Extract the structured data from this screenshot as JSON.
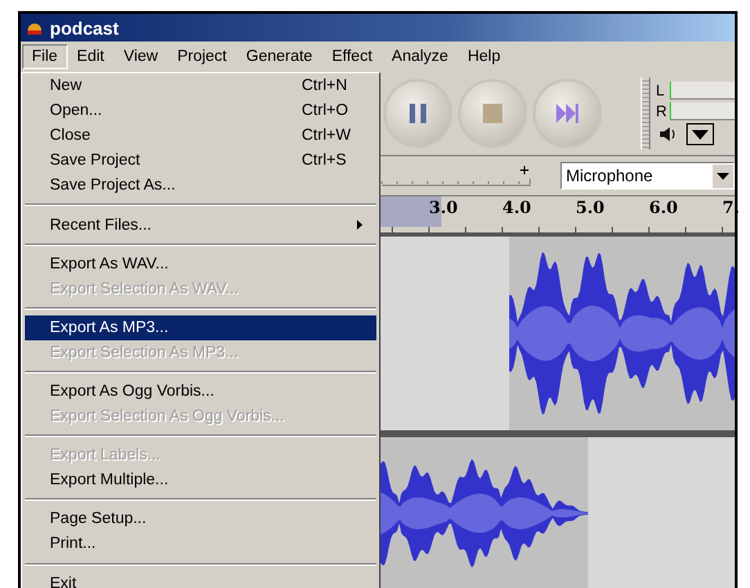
{
  "window": {
    "title": "podcast"
  },
  "menubar": [
    {
      "label": "File",
      "selected": true
    },
    {
      "label": "Edit",
      "selected": false
    },
    {
      "label": "View",
      "selected": false
    },
    {
      "label": "Project",
      "selected": false
    },
    {
      "label": "Generate",
      "selected": false
    },
    {
      "label": "Effect",
      "selected": false
    },
    {
      "label": "Analyze",
      "selected": false
    },
    {
      "label": "Help",
      "selected": false
    }
  ],
  "file_menu": [
    {
      "kind": "item",
      "label": "New",
      "shortcut": "Ctrl+N",
      "disabled": false,
      "selected": false
    },
    {
      "kind": "item",
      "label": "Open...",
      "shortcut": "Ctrl+O",
      "disabled": false,
      "selected": false
    },
    {
      "kind": "item",
      "label": "Close",
      "shortcut": "Ctrl+W",
      "disabled": false,
      "selected": false
    },
    {
      "kind": "item",
      "label": "Save Project",
      "shortcut": "Ctrl+S",
      "disabled": false,
      "selected": false
    },
    {
      "kind": "item",
      "label": "Save Project As...",
      "disabled": false,
      "selected": false
    },
    {
      "kind": "separator"
    },
    {
      "kind": "item",
      "label": "Recent Files...",
      "submenu": true,
      "disabled": false,
      "selected": false
    },
    {
      "kind": "separator"
    },
    {
      "kind": "item",
      "label": "Export As WAV...",
      "disabled": false,
      "selected": false
    },
    {
      "kind": "item",
      "label": "Export Selection As WAV...",
      "disabled": true,
      "selected": false
    },
    {
      "kind": "separator"
    },
    {
      "kind": "item",
      "label": "Export As MP3...",
      "disabled": false,
      "selected": true
    },
    {
      "kind": "item",
      "label": "Export Selection As MP3...",
      "disabled": true,
      "selected": false
    },
    {
      "kind": "separator"
    },
    {
      "kind": "item",
      "label": "Export As Ogg Vorbis...",
      "disabled": false,
      "selected": false
    },
    {
      "kind": "item",
      "label": "Export Selection As Ogg Vorbis...",
      "disabled": true,
      "selected": false
    },
    {
      "kind": "separator"
    },
    {
      "kind": "item",
      "label": "Export Labels...",
      "disabled": true,
      "selected": false
    },
    {
      "kind": "item",
      "label": "Export Multiple...",
      "disabled": false,
      "selected": false
    },
    {
      "kind": "separator"
    },
    {
      "kind": "item",
      "label": "Page Setup...",
      "disabled": false,
      "selected": false
    },
    {
      "kind": "item",
      "label": "Print...",
      "disabled": false,
      "selected": false
    },
    {
      "kind": "separator"
    },
    {
      "kind": "item",
      "label": "Exit",
      "disabled": false,
      "selected": false
    }
  ],
  "meter": {
    "left_label": "L",
    "right_label": "R"
  },
  "input_source": {
    "value": "Microphone"
  },
  "ruler": {
    "labels": [
      "3.0",
      "4.0",
      "5.0",
      "6.0",
      "7."
    ]
  }
}
